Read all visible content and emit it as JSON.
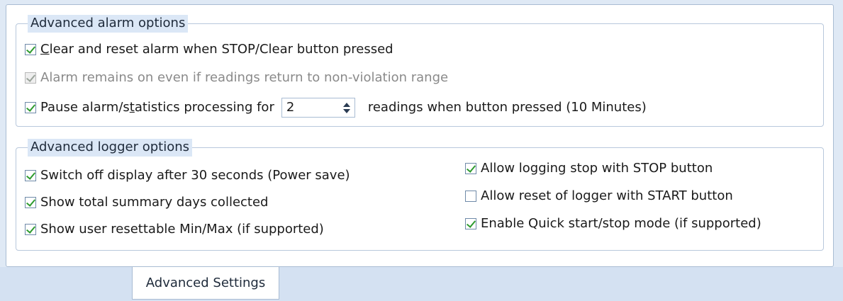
{
  "alarm_group": {
    "title": "Advanced alarm options",
    "clear_reset": {
      "label_pre": "",
      "label_u": "C",
      "label_post": "lear and reset alarm when STOP/Clear button pressed",
      "checked": true
    },
    "alarm_remains": {
      "label": "Alarm remains on even if readings return to non-violation range",
      "checked": true,
      "disabled": true
    },
    "pause_processing": {
      "label_pre": "Pause alarm/s",
      "label_u": "t",
      "label_post": "atistics processing for",
      "checked": true,
      "spin_value": "2",
      "suffix": "readings when button pressed (10 Minutes)"
    }
  },
  "logger_group": {
    "title": "Advanced logger options",
    "left": [
      {
        "label": "Switch off display after 30 seconds (Power save)",
        "checked": true
      },
      {
        "label": "Show total summary days collected",
        "checked": true
      },
      {
        "label": "Show user resettable Min/Max (if supported)",
        "checked": true
      }
    ],
    "right": [
      {
        "label": "Allow logging stop with STOP button",
        "checked": true
      },
      {
        "label": "Allow reset of logger with START button",
        "checked": false
      },
      {
        "label": "Enable Quick start/stop mode (if supported)",
        "checked": true
      }
    ]
  },
  "tabs": {
    "active_label": "Advanced Settings"
  }
}
